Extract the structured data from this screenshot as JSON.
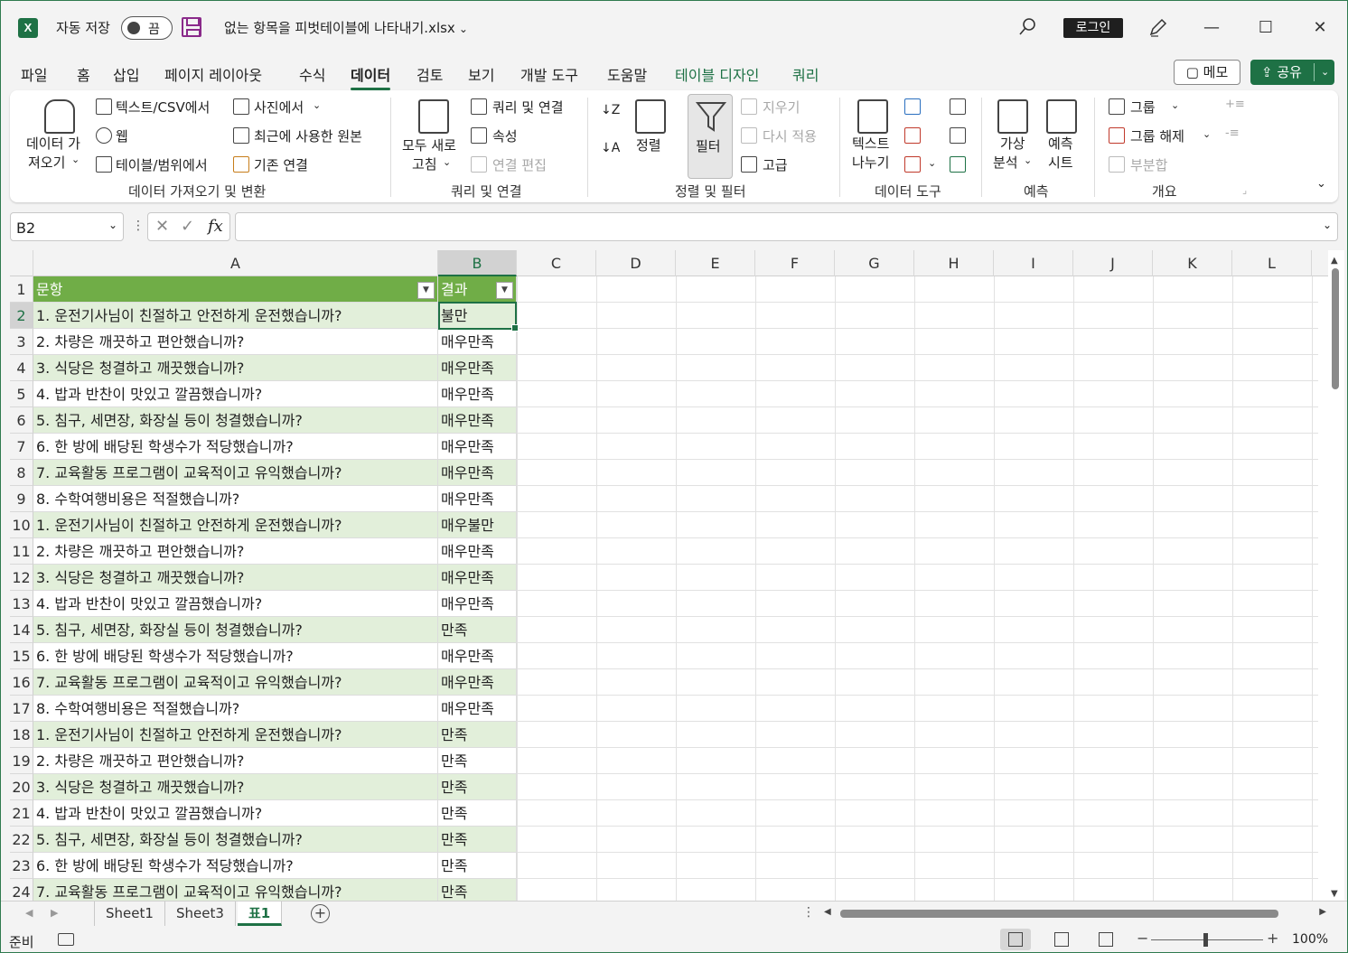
{
  "titlebar": {
    "app_logo": "X",
    "autosave_label": "자동 저장",
    "autosave_state": "끔",
    "doc_title": "없는 항목을 피벗테이블에 나타내기.xlsx",
    "login_label": "로그인",
    "icons": [
      "excel-logo-icon",
      "save-icon",
      "search-icon",
      "pen-icon",
      "minimize-icon",
      "maximize-icon",
      "close-icon"
    ]
  },
  "tabs": [
    "파일",
    "홈",
    "삽입",
    "페이지 레이아웃",
    "수식",
    "데이터",
    "검토",
    "보기",
    "개발 도구",
    "도움말",
    "테이블 디자인",
    "쿼리"
  ],
  "active_tab": "데이터",
  "memo_label": "메모",
  "share_label": "공유",
  "ribbon": {
    "get_data_1": "데이터 가",
    "get_data_2": "져오기",
    "text_csv": "텍스트/CSV에서",
    "web": "웹",
    "table_range": "테이블/범위에서",
    "from_picture": "사진에서",
    "recent_sources": "최근에 사용한 원본",
    "existing_connections": "기존 연결",
    "group_get": "데이터 가져오기 및 변환",
    "refresh_all_1": "모두 새로",
    "refresh_all_2": "고침",
    "queries_connections": "쿼리 및 연결",
    "properties": "속성",
    "edit_links": "연결 편집",
    "group_queries": "쿼리 및 연결",
    "sort": "정렬",
    "filter": "필터",
    "clear": "지우기",
    "reapply": "다시 적용",
    "advanced": "고급",
    "group_sort": "정렬 및 필터",
    "text_to_columns_1": "텍스트",
    "text_to_columns_2": "나누기",
    "group_datatools": "데이터 도구",
    "whatif_1": "가상",
    "whatif_2": "분석",
    "forecast_1": "예측",
    "forecast_2": "시트",
    "group_forecast": "예측",
    "group_btn": "그룹",
    "ungroup": "그룹 해제",
    "subtotal": "부분합",
    "group_outline": "개요"
  },
  "formula_bar": {
    "name_box": "B2",
    "formula": "",
    "fx": "fx"
  },
  "columns": [
    "A",
    "B",
    "C",
    "D",
    "E",
    "F",
    "G",
    "H",
    "I",
    "J",
    "K",
    "L"
  ],
  "table": {
    "headers": [
      "문항",
      "결과"
    ],
    "rows": [
      [
        "1. 운전기사님이 친절하고 안전하게 운전했습니까?",
        "불만"
      ],
      [
        "2. 차량은 깨끗하고 편안했습니까?",
        "매우만족"
      ],
      [
        "3. 식당은 청결하고 깨끗했습니까?",
        "매우만족"
      ],
      [
        "4. 밥과 반찬이 맛있고 깔끔했습니까?",
        "매우만족"
      ],
      [
        "5. 침구, 세면장, 화장실 등이 청결했습니까?",
        "매우만족"
      ],
      [
        "6. 한 방에 배당된 학생수가 적당했습니까?",
        "매우만족"
      ],
      [
        "7. 교육활동 프로그램이 교육적이고 유익했습니까?",
        "매우만족"
      ],
      [
        "8. 수학여행비용은 적절했습니까?",
        "매우만족"
      ],
      [
        "1. 운전기사님이 친절하고 안전하게 운전했습니까?",
        "매우불만"
      ],
      [
        "2. 차량은 깨끗하고 편안했습니까?",
        "매우만족"
      ],
      [
        "3. 식당은 청결하고 깨끗했습니까?",
        "매우만족"
      ],
      [
        "4. 밥과 반찬이 맛있고 깔끔했습니까?",
        "매우만족"
      ],
      [
        "5. 침구, 세면장, 화장실 등이 청결했습니까?",
        "만족"
      ],
      [
        "6. 한 방에 배당된 학생수가 적당했습니까?",
        "매우만족"
      ],
      [
        "7. 교육활동 프로그램이 교육적이고 유익했습니까?",
        "매우만족"
      ],
      [
        "8. 수학여행비용은 적절했습니까?",
        "매우만족"
      ],
      [
        "1. 운전기사님이 친절하고 안전하게 운전했습니까?",
        "만족"
      ],
      [
        "2. 차량은 깨끗하고 편안했습니까?",
        "만족"
      ],
      [
        "3. 식당은 청결하고 깨끗했습니까?",
        "만족"
      ],
      [
        "4. 밥과 반찬이 맛있고 깔끔했습니까?",
        "만족"
      ],
      [
        "5. 침구, 세면장, 화장실 등이 청결했습니까?",
        "만족"
      ],
      [
        "6. 한 방에 배당된 학생수가 적당했습니까?",
        "만족"
      ],
      [
        "7. 교육활동 프로그램이 교육적이고 유익했습니까?",
        "만족"
      ]
    ]
  },
  "sheets": [
    "Sheet1",
    "Sheet3",
    "표1"
  ],
  "active_sheet": "표1",
  "status": {
    "text": "준비",
    "zoom": "100%"
  },
  "colors": {
    "accent": "#1e7145",
    "table_header": "#70ad47",
    "band": "#e2efda"
  }
}
